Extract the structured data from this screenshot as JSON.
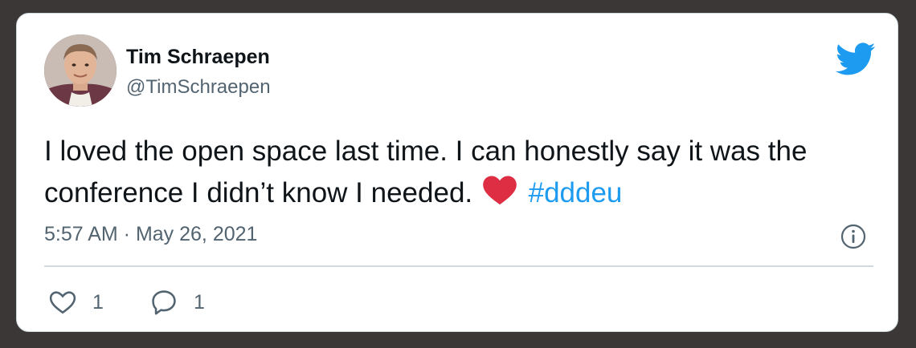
{
  "tweet": {
    "author_name": "Tim Schraepen",
    "author_handle": "@TimSchraepen",
    "text_main": "I loved the open space last time. I can honestly say it was the conference I didn’t know I needed.",
    "hashtag": "#dddeu",
    "timestamp": "5:57 AM · May 26, 2021",
    "likes": "1",
    "replies": "1"
  },
  "icons": {
    "brand": "twitter-bird-icon",
    "emoji": "red-heart-emoji",
    "info": "info-icon",
    "like": "heart-outline-icon",
    "reply": "speech-bubble-icon"
  },
  "colors": {
    "background": "#3b3736",
    "card": "#ffffff",
    "text": "#0f1419",
    "secondary_text": "#536471",
    "accent": "#1d9bf0",
    "heart_emoji": "#dd2e44",
    "divider": "#cfd9de"
  }
}
